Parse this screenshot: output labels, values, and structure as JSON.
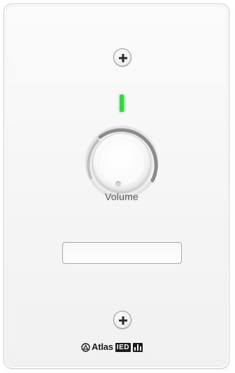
{
  "device": {
    "knob_label": "Volume",
    "brand": {
      "logo_text": "Atlas",
      "logo_box_text": "IED",
      "logo_icon": "atlas-mark-icon",
      "bars_icon": "signal-bars-icon"
    },
    "led": {
      "state": "on",
      "color": "#2bdc3a"
    },
    "knob": {
      "icon": "volume-knob"
    },
    "screw_icons": [
      "phillips-screw-icon",
      "phillips-screw-icon"
    ]
  }
}
